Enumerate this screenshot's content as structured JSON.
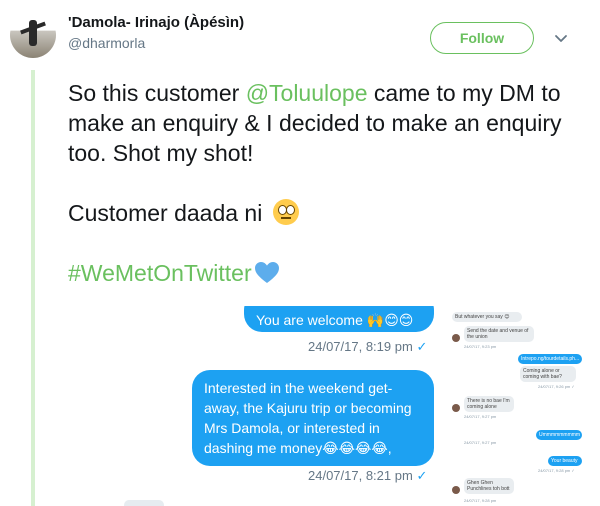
{
  "user": {
    "display_name": "'Damola- Irinajo (Àpésìn)",
    "handle": "@dharmorla"
  },
  "actions": {
    "follow_label": "Follow",
    "more_icon": "chevron-down-icon"
  },
  "tweet": {
    "line1_pre": "So this customer ",
    "mention": "@Toluulope",
    "line1_post": " came to my DM to make an enquiry & I decided to make an enquiry too. Shot my shot!",
    "line2": "Customer daada ni ",
    "hashtag": "#WeMetOnTwitter"
  },
  "colors": {
    "accent": "#6ac05f",
    "bubble": "#1da1f2",
    "secondary": "#657786"
  },
  "media": {
    "bubble1": "You are welcome 🙌😊😊",
    "time1": "24/07/17, 8:19 pm",
    "bubble2": "Interested in the weekend get-away, the Kajuru trip or becoming Mrs Damola, or interested in dashing me money😂😂😂😂,",
    "time2": "24/07/17, 8:21 pm",
    "check_icon": "✓",
    "thumb": {
      "m1": "But whatever you say 😊",
      "m2": "Send the date and venue of the union",
      "t1": "24/07/17, 9:23 pm",
      "m3": "Intrepo.ng/tourdetails.ph...",
      "m4": "Coming alone or coming with bae?",
      "t2": "24/07/17, 9:26 pm ✓",
      "m5": "There is no bae I'm coming alone",
      "t3": "24/07/17, 9:27 pm",
      "m6": "Ummmmmmmmm",
      "t4": "24/07/17, 9:27 pm",
      "m7": "Your beauty",
      "t5": "24/07/17, 9:28 pm ✓",
      "m8": "Ghen Ghen Punchlines toh bott",
      "t6": "24/07/17, 9:28 pm"
    }
  }
}
